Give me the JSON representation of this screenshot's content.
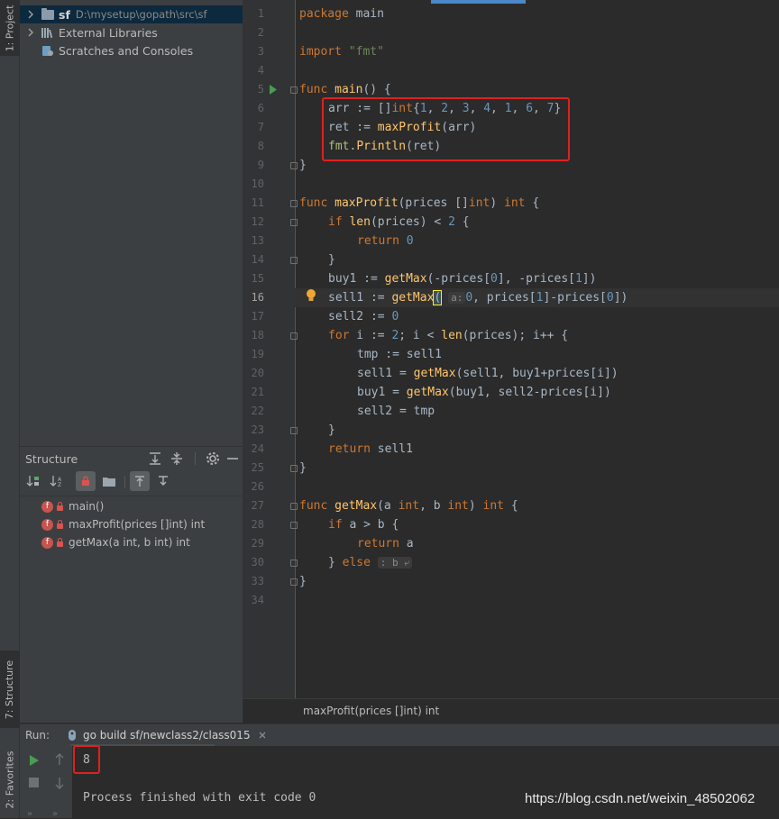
{
  "left_stripe": {
    "project_tab": "1: Project",
    "structure_tab": "7: Structure",
    "favorites_tab": "2: Favorites"
  },
  "project_tree": {
    "root_name": "sf",
    "root_path": "D:\\mysetup\\gopath\\src\\sf",
    "external_libraries": "External Libraries",
    "scratches": "Scratches and Consoles"
  },
  "structure": {
    "title": "Structure",
    "items": [
      {
        "badge": "f",
        "label": "main()"
      },
      {
        "badge": "f",
        "label": "maxProfit(prices []int) int"
      },
      {
        "badge": "f",
        "label": "getMax(a int, b int) int"
      }
    ]
  },
  "editor": {
    "line_numbers": [
      "1",
      "2",
      "3",
      "4",
      "5",
      "6",
      "7",
      "8",
      "9",
      "10",
      "11",
      "12",
      "13",
      "14",
      "15",
      "16",
      "17",
      "18",
      "19",
      "20",
      "21",
      "22",
      "23",
      "24",
      "25",
      "26",
      "27",
      "28",
      "29",
      "30",
      "33",
      "34"
    ],
    "current_line": "16",
    "lines": {
      "l1": {
        "kw": "package",
        "rest": " main"
      },
      "l3": {
        "kw": "import",
        "str": "\"fmt\""
      },
      "l5": {
        "kw": "func",
        "name": "main",
        "rest": "() {"
      },
      "l6": {
        "a": "arr := []",
        "kw": "int",
        "b": "{",
        "nums": [
          "1",
          "2",
          "3",
          "4",
          "1",
          "6",
          "7"
        ],
        "c": "}"
      },
      "l7": {
        "a": "ret := ",
        "call": "maxProfit",
        "b": "(arr)"
      },
      "l8": {
        "pkg": "fmt",
        "dot": ".",
        "call": "Println",
        "b": "(ret)"
      },
      "l9": "}",
      "l11": {
        "kw": "func",
        "name": "maxProfit",
        "a": "(prices []",
        "kw2": "int",
        "b": ") ",
        "kw3": "int",
        "c": " {"
      },
      "l12": {
        "kw": "if",
        "call": "len",
        "a": "(prices) < ",
        "num": "2",
        "b": " {"
      },
      "l13": {
        "kw": "return",
        "num": "0"
      },
      "l14": "}",
      "l15": {
        "a": "buy1 := ",
        "call": "getMax",
        "b": "(-prices[",
        "n1": "0",
        "c": "], -prices[",
        "n2": "1",
        "d": "])"
      },
      "l16": {
        "a": "sell1 := ",
        "call": "getMax",
        "b": "(",
        "hint": "a:",
        "n1": "0",
        "c": ", prices[",
        "n2": "1",
        "d": "]-prices[",
        "n3": "0",
        "e": "])"
      },
      "l17": {
        "a": "sell2 := ",
        "num": "0"
      },
      "l18": {
        "kw": "for",
        "a": " i := ",
        "n1": "2",
        "b": "; i < ",
        "call": "len",
        "c": "(prices); i++ {"
      },
      "l19": "tmp := sell1",
      "l20": {
        "a": "sell1 = ",
        "call": "getMax",
        "b": "(sell1, buy1+prices[i])"
      },
      "l21": {
        "a": "buy1 = ",
        "call": "getMax",
        "b": "(buy1, sell2-prices[i])"
      },
      "l22": "sell2 = tmp",
      "l23": "}",
      "l24": {
        "kw": "return",
        "rest": " sell1"
      },
      "l25": "}",
      "l27": {
        "kw": "func",
        "name": "getMax",
        "a": "(a ",
        "kw2": "int",
        "b": ", b ",
        "kw3": "int",
        "c": ") ",
        "kw4": "int",
        "d": " {"
      },
      "l28": {
        "kw": "if",
        "rest": " a > b {"
      },
      "l29": {
        "kw": "return",
        "rest": " a"
      },
      "l30": {
        "a": "} ",
        "kw": "else",
        "hint": ": b ⤶"
      },
      "l33": "}"
    }
  },
  "breadcrumb": "maxProfit(prices []int) int",
  "run": {
    "label": "Run:",
    "tab": "go build sf/newclass2/class015",
    "output_value": "8",
    "process_message": "Process finished with exit code 0"
  },
  "watermark": "https://blog.csdn.net/weixin_48502062",
  "colors": {
    "keyword": "#cc7832",
    "function": "#ffc66d",
    "number": "#6897bb",
    "string": "#6a8759",
    "highlight_box": "#e02020"
  }
}
